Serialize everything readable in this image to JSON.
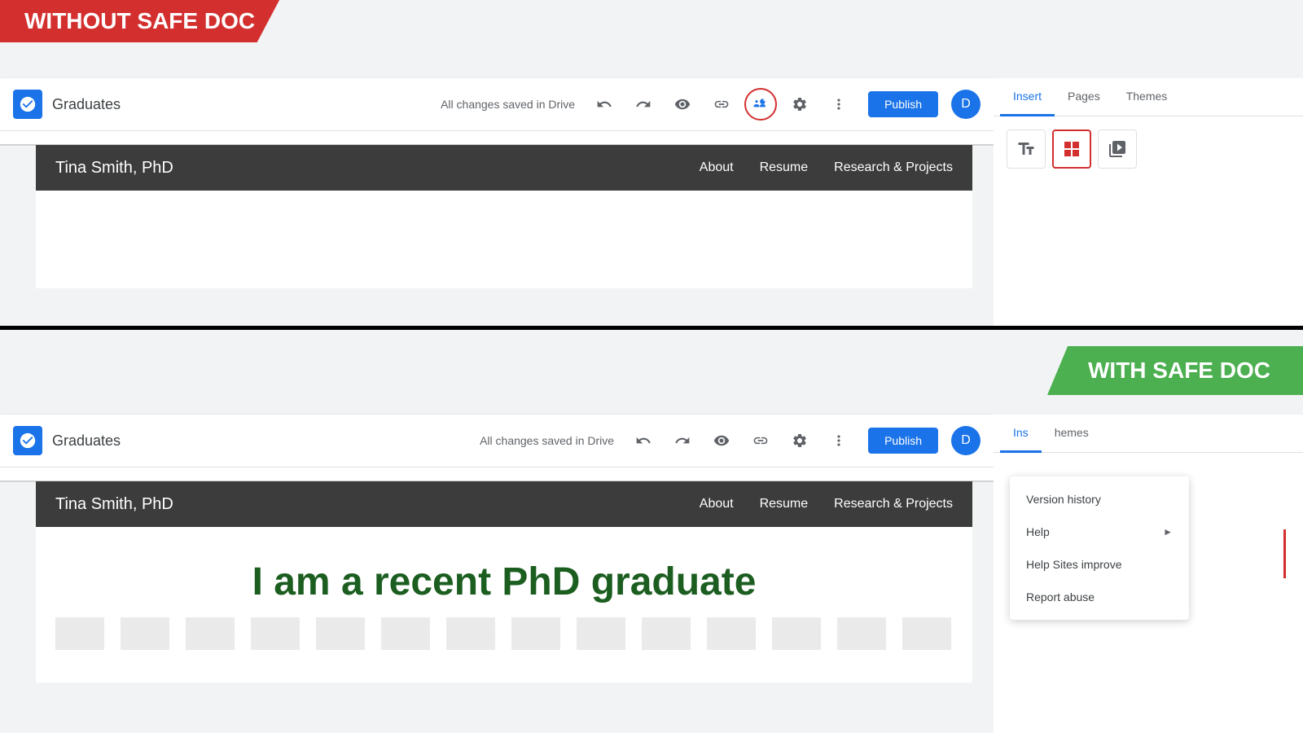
{
  "without_banner": {
    "text": "WITHOUT SAFE DOC"
  },
  "with_banner": {
    "text": "WITH SAFE DOC"
  },
  "top_toolbar": {
    "site_name": "Graduates",
    "save_status": "All changes saved in Drive",
    "undo_label": "Undo",
    "redo_label": "Redo",
    "preview_label": "Preview",
    "link_label": "Copy link",
    "share_label": "Share",
    "settings_label": "Settings",
    "more_label": "More options",
    "publish_label": "Publish",
    "avatar_letter": "D"
  },
  "bottom_toolbar": {
    "site_name": "Graduates",
    "save_status": "All changes saved in Drive",
    "publish_label": "Publish",
    "avatar_letter": "D"
  },
  "top_site": {
    "title": "Tina Smith, PhD",
    "nav": {
      "about": "About",
      "resume": "Resume",
      "research": "Research & Projects"
    }
  },
  "bottom_site": {
    "title": "Tina Smith, PhD",
    "nav": {
      "about": "About",
      "resume": "Resume",
      "research": "Research & Projects"
    },
    "hero_text": "I am a recent PhD graduate"
  },
  "right_panel_top": {
    "tabs": [
      "Insert",
      "Pages",
      "Themes"
    ],
    "active_tab": "Insert"
  },
  "right_panel_bottom": {
    "tabs": [
      "Ins",
      "hemes"
    ],
    "active_tab": "Ins"
  },
  "dropdown_menu": {
    "items": [
      {
        "label": "Version history",
        "has_arrow": false
      },
      {
        "label": "Help",
        "has_arrow": true
      },
      {
        "label": "Help Sites improve",
        "has_arrow": false
      },
      {
        "label": "Report abuse",
        "has_arrow": false
      }
    ]
  }
}
